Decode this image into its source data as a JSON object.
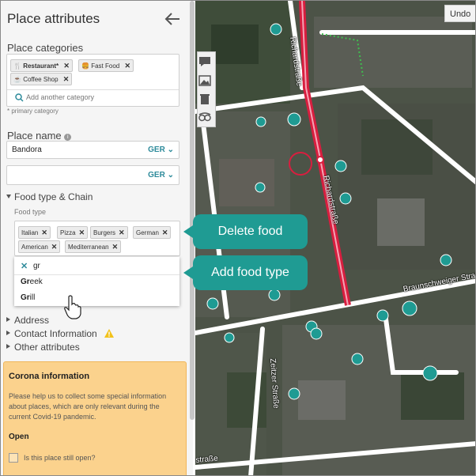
{
  "panel": {
    "title": "Place attributes",
    "place_categories_label": "Place categories",
    "categories": [
      {
        "icon": "fork-knife-icon",
        "label": "Restaurant*"
      },
      {
        "icon": "fast-food-icon",
        "label": "Fast Food"
      },
      {
        "icon": "coffee-cup-icon",
        "label": "Coffee Shop"
      }
    ],
    "add_category_placeholder": "Add another category",
    "primary_note": "* primary category",
    "place_name_label": "Place name",
    "place_name_value": "Bandora",
    "lang_1": "GER",
    "lang_2": "GER",
    "food_type_chain_label": "Food type & Chain",
    "food_type_label": "Food type",
    "food_types": [
      "Italian",
      "Pizza",
      "Burgers",
      "German",
      "American",
      "Mediterranean"
    ],
    "food_search_value": "gr",
    "suggestions": [
      {
        "bold": "Gr",
        "rest": "eek"
      },
      {
        "bold": "Gr",
        "rest": "ill"
      }
    ],
    "address_label": "Address",
    "contact_label": "Contact Information",
    "other_label": "Other attributes",
    "corona": {
      "title": "Corona information",
      "description": "Please help us to collect some special information about places, which are only relevant during the current Covid-19 pandemic.",
      "open_label": "Open",
      "open_question": "Is this place still open?"
    }
  },
  "map": {
    "undo_label": "Undo",
    "streets": [
      "Richardstraße",
      "Richardstraße",
      "Braunschweiger Straße",
      "Zeitzer Straße",
      "straße"
    ]
  },
  "callouts": {
    "delete_food": "Delete food",
    "add_food_type": "Add food type"
  },
  "colors": {
    "accent": "#2e8b9b",
    "callout": "#1f9b93",
    "selected_road": "#d81e3f",
    "warning": "#f2c21b",
    "corona_bg": "#fbd28d"
  }
}
